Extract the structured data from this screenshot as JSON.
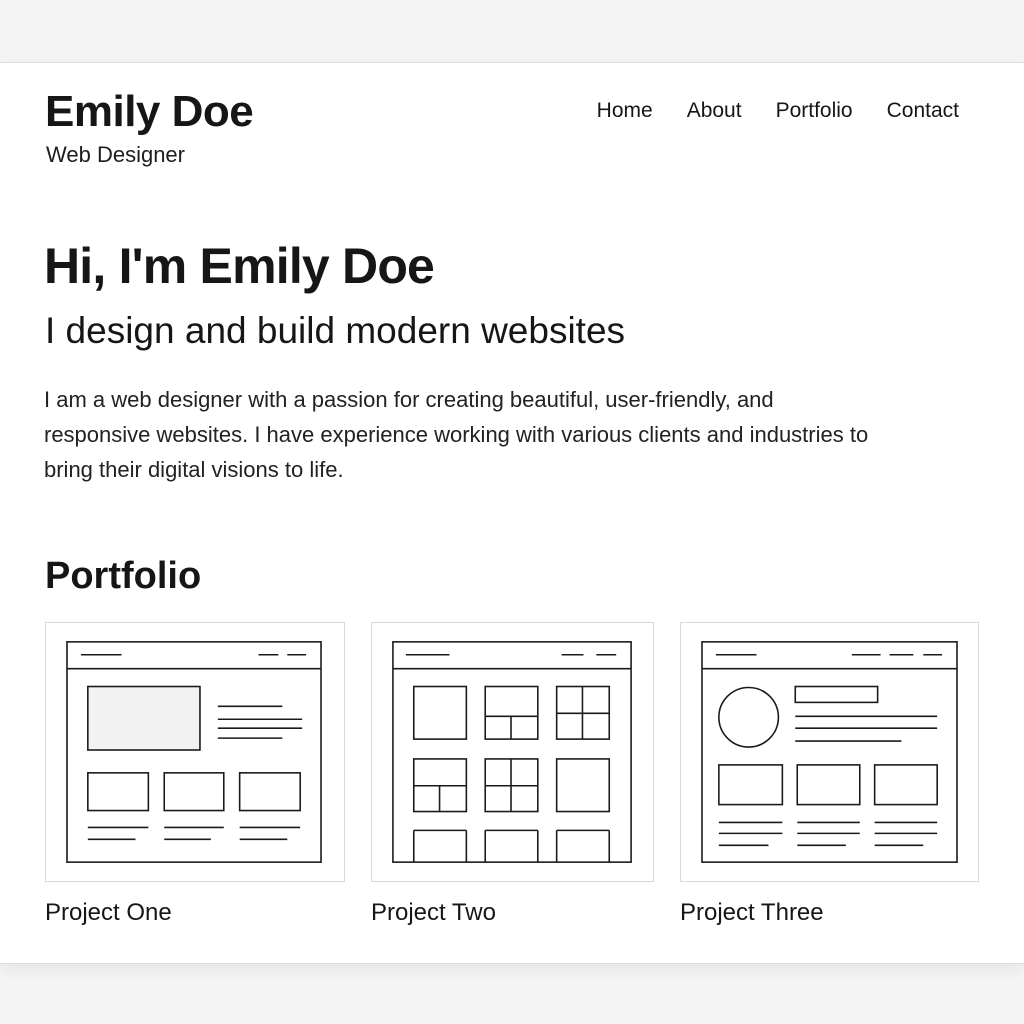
{
  "header": {
    "name": "Emily Doe",
    "role": "Web Designer"
  },
  "nav": {
    "items": [
      {
        "label": "Home"
      },
      {
        "label": "About"
      },
      {
        "label": "Portfolio"
      },
      {
        "label": "Contact"
      }
    ]
  },
  "hero": {
    "title": "Hi, I'm Emily Doe",
    "subtitle": "I design and build modern websites",
    "body": "I am a web designer with a passion for creating beautiful, user-friendly, and responsive websites. I have experience working with various clients and industries to bring their digital visions to life."
  },
  "portfolio": {
    "title": "Portfolio",
    "projects": [
      {
        "label": "Project One",
        "thumbnail": "wireframe-hero-layout"
      },
      {
        "label": "Project Two",
        "thumbnail": "wireframe-grid-layout"
      },
      {
        "label": "Project Three",
        "thumbnail": "wireframe-profile-layout"
      }
    ]
  },
  "colors": {
    "text": "#161616",
    "page_bg": "#f4f4f4",
    "card_border": "#d8d8d8"
  }
}
